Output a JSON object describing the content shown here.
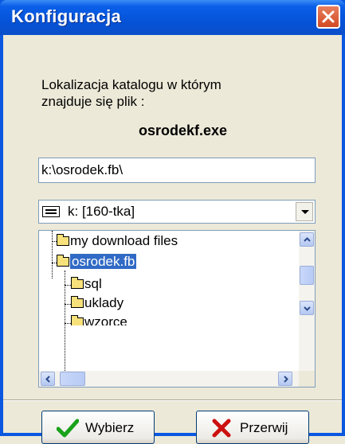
{
  "window": {
    "title": "Konfiguracja"
  },
  "dialog": {
    "label_line1": "Lokalizacja katalogu w którym",
    "label_line2": "znajduje się plik :",
    "filename": "osrodekf.exe",
    "path_value": "k:\\osrodek.fb\\",
    "drive_selected": "k: [160-tka]"
  },
  "tree": {
    "items": [
      {
        "label": "my download files",
        "selected": false
      },
      {
        "label": "osrodek.fb",
        "selected": true
      },
      {
        "label": "sql",
        "selected": false
      },
      {
        "label": "uklady",
        "selected": false
      },
      {
        "label": "wzorce",
        "selected": false
      }
    ]
  },
  "buttons": {
    "ok_label": "Wybierz",
    "cancel_label": "Przerwij"
  },
  "colors": {
    "titlebar": "#0553d8",
    "selection": "#316ac5",
    "close": "#d24a23",
    "ok_icon": "#1aa11a",
    "cancel_icon": "#cc1010"
  },
  "icons": [
    "close-icon",
    "drive-icon",
    "folder-icon",
    "open-folder-icon",
    "checkmark-icon",
    "x-icon",
    "arrow-up-icon",
    "arrow-down-icon",
    "arrow-left-icon",
    "arrow-right-icon"
  ]
}
